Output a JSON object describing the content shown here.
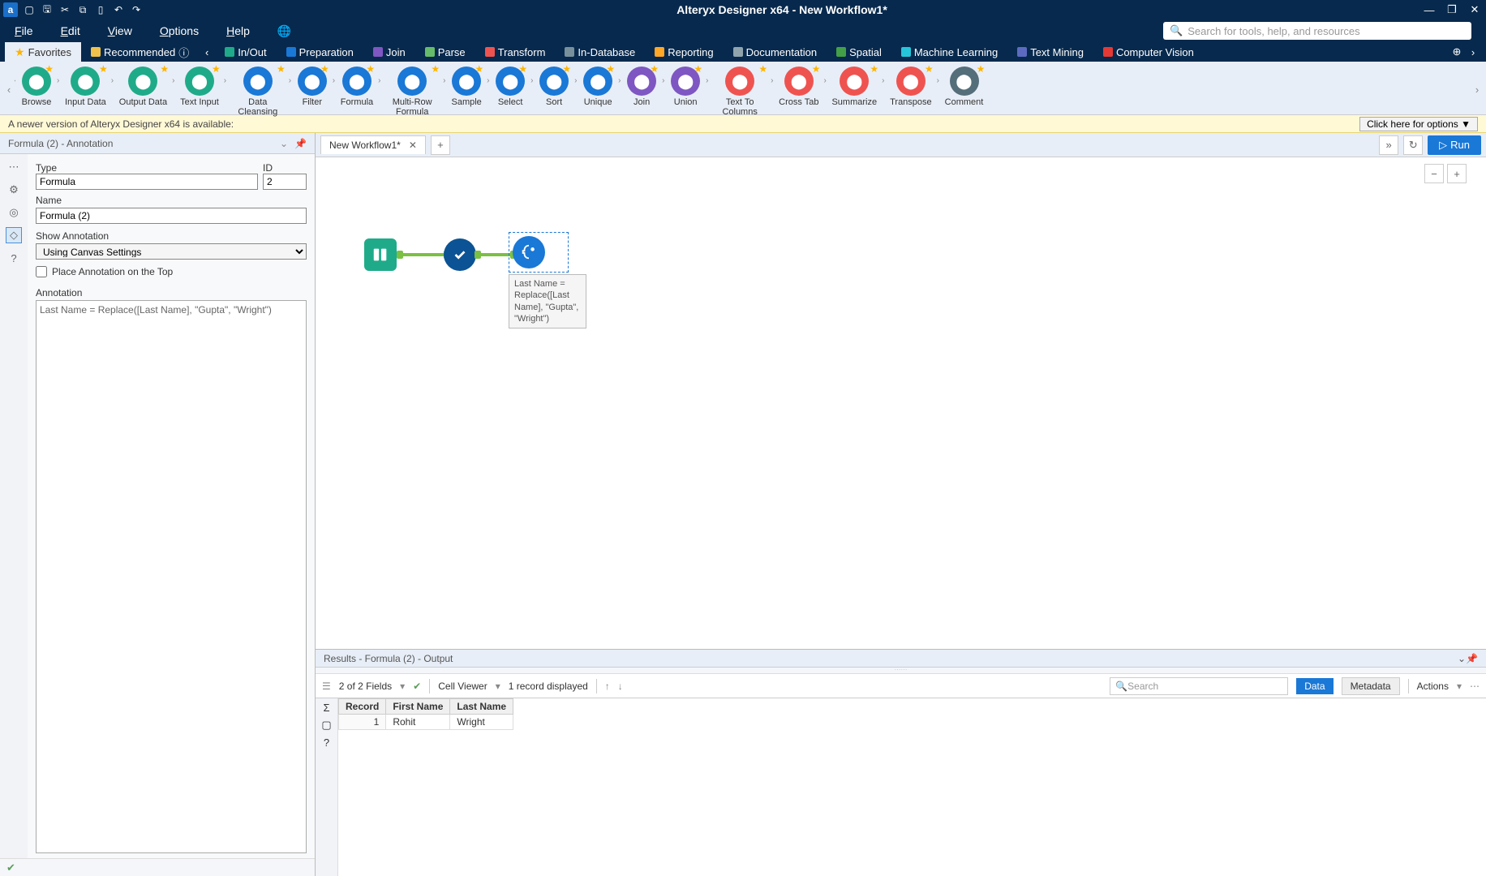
{
  "titlebar": {
    "title": "Alteryx Designer x64 - New Workflow1*"
  },
  "menubar": [
    "File",
    "Edit",
    "View",
    "Options",
    "Help"
  ],
  "search_placeholder": "Search for tools, help, and resources",
  "ribbon_tabs": [
    {
      "label": "Favorites",
      "color": "#ffb400",
      "active": true,
      "star": true
    },
    {
      "label": "Recommended",
      "color": "#f0c14b",
      "info": true
    },
    {
      "label": "In/Out",
      "color": "#1fab89"
    },
    {
      "label": "Preparation",
      "color": "#1a78d6"
    },
    {
      "label": "Join",
      "color": "#7e57c2"
    },
    {
      "label": "Parse",
      "color": "#66bb6a"
    },
    {
      "label": "Transform",
      "color": "#ef5350"
    },
    {
      "label": "In-Database",
      "color": "#78909c"
    },
    {
      "label": "Reporting",
      "color": "#ffa726"
    },
    {
      "label": "Documentation",
      "color": "#90a4ae"
    },
    {
      "label": "Spatial",
      "color": "#43a047"
    },
    {
      "label": "Machine Learning",
      "color": "#26c6da"
    },
    {
      "label": "Text Mining",
      "color": "#5c6bc0"
    },
    {
      "label": "Computer Vision",
      "color": "#e53935"
    }
  ],
  "tools": [
    {
      "label": "Browse",
      "color": "#1fab89"
    },
    {
      "label": "Input Data",
      "color": "#1fab89"
    },
    {
      "label": "Output Data",
      "color": "#1fab89"
    },
    {
      "label": "Text Input",
      "color": "#1fab89"
    },
    {
      "label": "Data Cleansing",
      "color": "#1a78d6"
    },
    {
      "label": "Filter",
      "color": "#1a78d6"
    },
    {
      "label": "Formula",
      "color": "#1a78d6"
    },
    {
      "label": "Multi-Row Formula",
      "color": "#1a78d6"
    },
    {
      "label": "Sample",
      "color": "#1a78d6"
    },
    {
      "label": "Select",
      "color": "#1a78d6"
    },
    {
      "label": "Sort",
      "color": "#1a78d6"
    },
    {
      "label": "Unique",
      "color": "#1a78d6"
    },
    {
      "label": "Join",
      "color": "#7e57c2"
    },
    {
      "label": "Union",
      "color": "#7e57c2"
    },
    {
      "label": "Text To Columns",
      "color": "#ef5350"
    },
    {
      "label": "Cross Tab",
      "color": "#ef5350"
    },
    {
      "label": "Summarize",
      "color": "#ef5350"
    },
    {
      "label": "Transpose",
      "color": "#ef5350"
    },
    {
      "label": "Comment",
      "color": "#546e7a"
    }
  ],
  "notification": {
    "text": "A newer version of Alteryx Designer x64 is available:",
    "button": "Click here for options ▼"
  },
  "config": {
    "header": "Formula (2) - Annotation",
    "type_label": "Type",
    "type_value": "Formula",
    "id_label": "ID",
    "id_value": "2",
    "name_label": "Name",
    "name_value": "Formula (2)",
    "show_anno_label": "Show Annotation",
    "show_anno_value": "Using Canvas Settings",
    "place_top_label": "Place Annotation on the Top",
    "annotation_label": "Annotation",
    "annotation_value": "Last Name = Replace([Last Name], \"Gupta\", \"Wright\")"
  },
  "canvas": {
    "tab_label": "New Workflow1*",
    "run_label": "Run",
    "annotation_text": "Last Name = Replace([Last Name], \"Gupta\", \"Wright\")"
  },
  "results": {
    "header": "Results - Formula (2) - Output",
    "fields_summary": "2 of 2 Fields",
    "cell_viewer": "Cell Viewer",
    "records_summary": "1 record displayed",
    "search_placeholder": "Search",
    "data_btn": "Data",
    "metadata_btn": "Metadata",
    "actions_btn": "Actions",
    "columns": [
      "Record",
      "First Name",
      "Last Name"
    ],
    "rows": [
      {
        "record": "1",
        "first_name": "Rohit",
        "last_name": "Wright"
      }
    ]
  }
}
